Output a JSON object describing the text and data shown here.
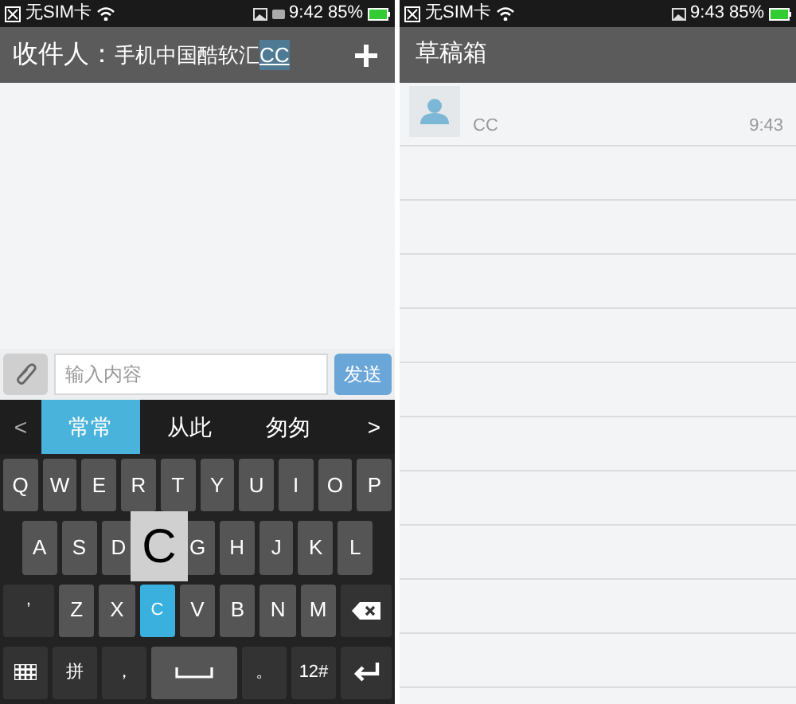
{
  "left_screen": {
    "status_bar": {
      "carrier": "无SIM卡",
      "time": "9:42",
      "battery": "85%"
    },
    "title_bar": {
      "label": "收件人：",
      "recipient": "手机中国酷软汇",
      "composing": "CC"
    },
    "compose": {
      "placeholder": "输入内容",
      "send": "发送"
    },
    "candidates": {
      "prev": "<",
      "next": ">",
      "items": [
        {
          "label": "常常",
          "selected": true
        },
        {
          "label": "从此",
          "selected": false
        },
        {
          "label": "匆匆",
          "selected": false
        }
      ]
    },
    "keyboard": {
      "rows": [
        {
          "keys": [
            {
              "kind": "letter",
              "label": "Q"
            },
            {
              "kind": "letter",
              "label": "W"
            },
            {
              "kind": "letter",
              "label": "E"
            },
            {
              "kind": "letter",
              "label": "R"
            },
            {
              "kind": "letter",
              "label": "T"
            },
            {
              "kind": "letter",
              "label": "Y"
            },
            {
              "kind": "letter",
              "label": "U"
            },
            {
              "kind": "letter",
              "label": "I"
            },
            {
              "kind": "letter",
              "label": "O"
            },
            {
              "kind": "letter",
              "label": "P"
            }
          ]
        },
        {
          "keys": [
            {
              "kind": "letter",
              "label": "A"
            },
            {
              "kind": "letter",
              "label": "S"
            },
            {
              "kind": "letter",
              "label": "D"
            },
            {
              "kind": "covered"
            },
            {
              "kind": "letter",
              "label": "G"
            },
            {
              "kind": "letter",
              "label": "H"
            },
            {
              "kind": "letter",
              "label": "J"
            },
            {
              "kind": "letter",
              "label": "K"
            },
            {
              "kind": "letter",
              "label": "L"
            }
          ]
        },
        {
          "keys": [
            {
              "kind": "dark",
              "label": "’"
            },
            {
              "kind": "letter",
              "label": "Z"
            },
            {
              "kind": "letter",
              "label": "X"
            },
            {
              "kind": "pressed",
              "label": "C"
            },
            {
              "kind": "letter",
              "label": "V"
            },
            {
              "kind": "letter",
              "label": "B"
            },
            {
              "kind": "letter",
              "label": "N"
            },
            {
              "kind": "letter",
              "label": "M"
            },
            {
              "kind": "backspace"
            }
          ]
        },
        {
          "keys": [
            {
              "kind": "grid"
            },
            {
              "kind": "dark",
              "label": "拼"
            },
            {
              "kind": "dark",
              "label": "，"
            },
            {
              "kind": "space"
            },
            {
              "kind": "dark",
              "label": "。"
            },
            {
              "kind": "dark",
              "label": "12#"
            },
            {
              "kind": "enter"
            }
          ]
        }
      ],
      "popup": "C"
    }
  },
  "right_screen": {
    "status_bar": {
      "carrier": "无SIM卡",
      "time": "9:43",
      "battery": "85%"
    },
    "title": "草稿箱",
    "drafts": [
      {
        "name": "CC",
        "time": "9:43"
      }
    ]
  }
}
